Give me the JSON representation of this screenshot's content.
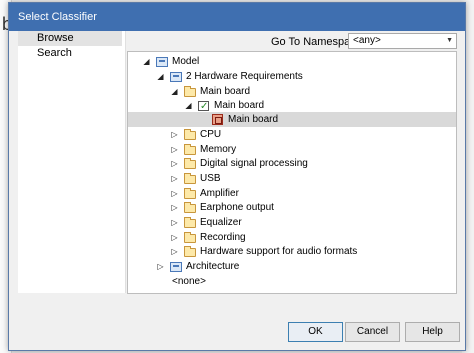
{
  "background": {
    "letter": "b"
  },
  "dialog": {
    "title": "Select Classifier"
  },
  "left_tabs": [
    {
      "label": "Browse",
      "active": true
    },
    {
      "label": "Search",
      "active": false
    }
  ],
  "namespace": {
    "label": "Go To Namespace:",
    "value": "<any>"
  },
  "tree": [
    {
      "label": "Model",
      "icon": "model-icon",
      "expander": "expanded"
    },
    {
      "label": "2 Hardware Requirements",
      "icon": "package-icon",
      "expander": "expanded"
    },
    {
      "label": "Main board",
      "icon": "folder-icon",
      "expander": "expanded"
    },
    {
      "label": "Main board",
      "icon": "diagram-icon",
      "expander": "expanded"
    },
    {
      "label": "Main board",
      "icon": "block-icon",
      "expander": "none",
      "selected": true
    },
    {
      "label": "CPU",
      "icon": "folder-icon",
      "expander": "collapsed"
    },
    {
      "label": "Memory",
      "icon": "folder-icon",
      "expander": "collapsed"
    },
    {
      "label": "Digital signal processing",
      "icon": "folder-icon",
      "expander": "collapsed"
    },
    {
      "label": "USB",
      "icon": "folder-icon",
      "expander": "collapsed"
    },
    {
      "label": "Amplifier",
      "icon": "folder-icon",
      "expander": "collapsed"
    },
    {
      "label": "Earphone output",
      "icon": "folder-icon",
      "expander": "collapsed"
    },
    {
      "label": "Equalizer",
      "icon": "folder-icon",
      "expander": "collapsed"
    },
    {
      "label": "Recording",
      "icon": "folder-icon",
      "expander": "collapsed"
    },
    {
      "label": "Hardware support for audio formats",
      "icon": "folder-icon",
      "expander": "collapsed"
    },
    {
      "label": "Architecture",
      "icon": "package-icon",
      "expander": "collapsed"
    },
    {
      "label": "<none>",
      "icon": "",
      "expander": "none"
    }
  ],
  "buttons": {
    "ok": "OK",
    "cancel": "Cancel",
    "help": "Help"
  },
  "colors": {
    "titlebar": "#3f6fb0",
    "selection": "#d9d9d9",
    "default_button_border": "#3c7fb1"
  }
}
